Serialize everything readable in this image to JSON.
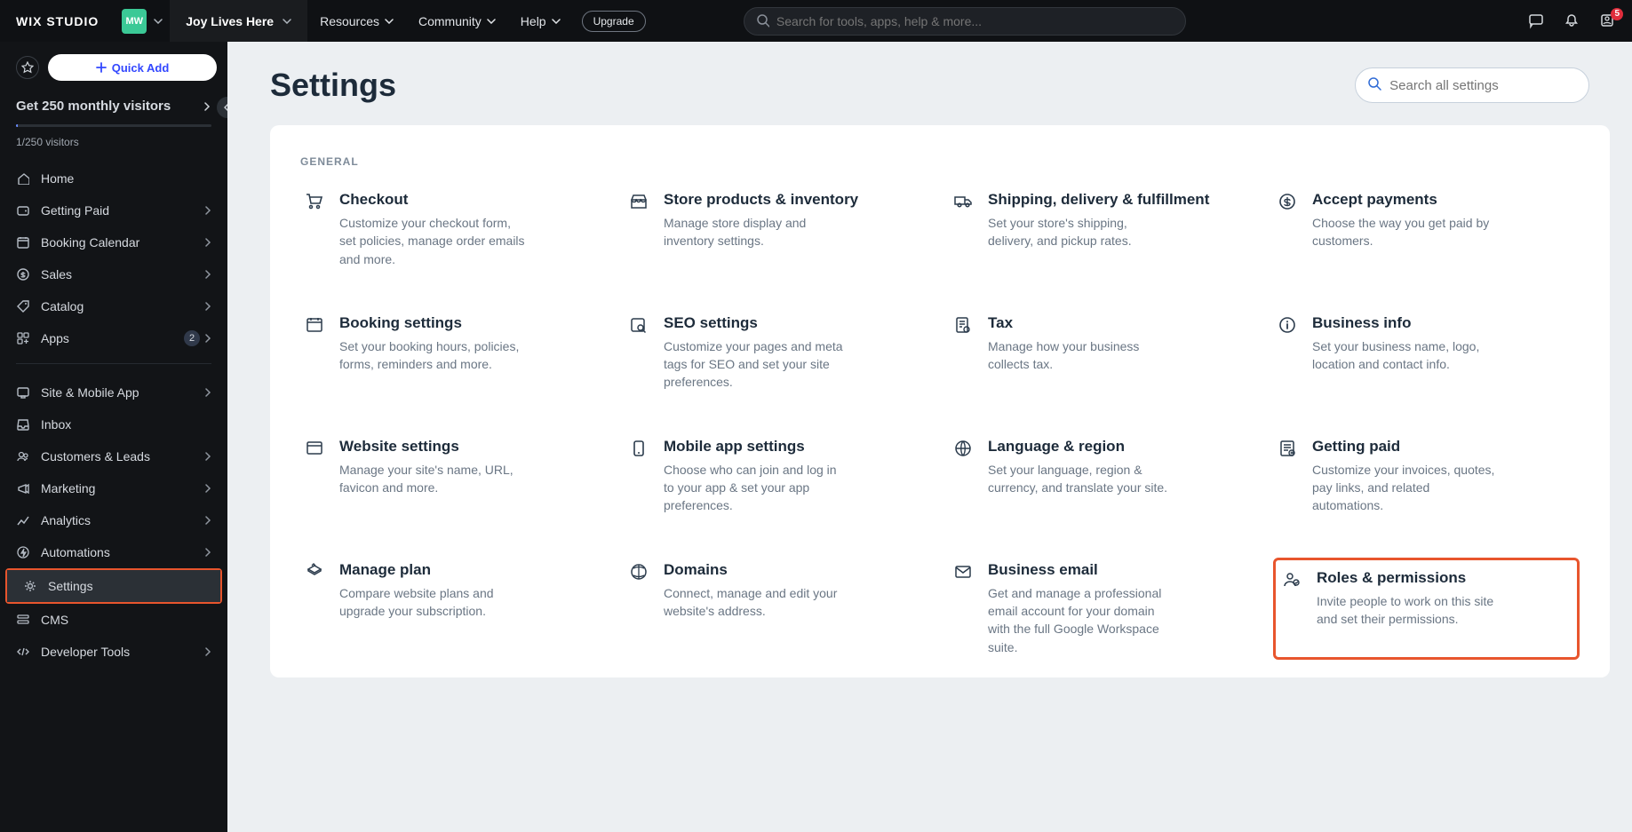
{
  "top": {
    "logo": "WIX STUDIO",
    "avatar_initials": "MW",
    "site_name": "Joy Lives Here",
    "nav": [
      "Resources",
      "Community",
      "Help"
    ],
    "upgrade": "Upgrade",
    "search_placeholder": "Search for tools, apps, help & more...",
    "badge_count": "5"
  },
  "sidebar": {
    "quick_add": "Quick Add",
    "visitors_title": "Get 250 monthly visitors",
    "visitors_count": "1/250 visitors",
    "items": [
      {
        "label": "Home",
        "icon": "home",
        "chev": false
      },
      {
        "label": "Getting Paid",
        "icon": "wallet",
        "chev": true
      },
      {
        "label": "Booking Calendar",
        "icon": "calendar",
        "chev": true
      },
      {
        "label": "Sales",
        "icon": "dollar",
        "chev": true
      },
      {
        "label": "Catalog",
        "icon": "tag",
        "chev": true
      },
      {
        "label": "Apps",
        "icon": "apps",
        "chev": true,
        "badge": "2"
      }
    ],
    "items2": [
      {
        "label": "Site & Mobile App",
        "icon": "site",
        "chev": true
      },
      {
        "label": "Inbox",
        "icon": "inbox",
        "chev": false
      },
      {
        "label": "Customers & Leads",
        "icon": "users",
        "chev": true
      },
      {
        "label": "Marketing",
        "icon": "mega",
        "chev": true
      },
      {
        "label": "Analytics",
        "icon": "chart",
        "chev": true
      },
      {
        "label": "Automations",
        "icon": "bolt",
        "chev": true
      },
      {
        "label": "Settings",
        "icon": "gear",
        "chev": false,
        "active": true
      },
      {
        "label": "CMS",
        "icon": "cms",
        "chev": false
      },
      {
        "label": "Developer Tools",
        "icon": "dev",
        "chev": true
      }
    ]
  },
  "main": {
    "title": "Settings",
    "search_placeholder": "Search all settings",
    "section": "GENERAL",
    "cards": [
      {
        "title": "Checkout",
        "desc": "Customize your checkout form, set policies, manage order emails and more.",
        "icon": "cart"
      },
      {
        "title": "Store products & inventory",
        "desc": "Manage store display and inventory settings.",
        "icon": "store"
      },
      {
        "title": "Shipping, delivery & fulfillment",
        "desc": "Set your store's shipping, delivery, and pickup rates.",
        "icon": "truck"
      },
      {
        "title": "Accept payments",
        "desc": "Choose the way you get paid by customers.",
        "icon": "pay"
      },
      {
        "title": "Booking settings",
        "desc": "Set your booking hours, policies, forms, reminders and more.",
        "icon": "book"
      },
      {
        "title": "SEO settings",
        "desc": "Customize your pages and meta tags for SEO and set your site preferences.",
        "icon": "seo"
      },
      {
        "title": "Tax",
        "desc": "Manage how your business collects tax.",
        "icon": "tax"
      },
      {
        "title": "Business info",
        "desc": "Set your business name, logo, location and contact info.",
        "icon": "info"
      },
      {
        "title": "Website settings",
        "desc": "Manage your site's name, URL, favicon and more.",
        "icon": "web"
      },
      {
        "title": "Mobile app settings",
        "desc": "Choose who can join and log in to your app & set your app preferences.",
        "icon": "mobile"
      },
      {
        "title": "Language & region",
        "desc": "Set your language, region & currency, and translate your site.",
        "icon": "globe"
      },
      {
        "title": "Getting paid",
        "desc": "Customize your invoices, quotes, pay links, and related automations.",
        "icon": "invoice"
      },
      {
        "title": "Manage plan",
        "desc": "Compare website plans and upgrade your subscription.",
        "icon": "plan"
      },
      {
        "title": "Domains",
        "desc": "Connect, manage and edit your website's address.",
        "icon": "domain"
      },
      {
        "title": "Business email",
        "desc": "Get and manage a professional email account for your domain with the full Google Workspace suite.",
        "icon": "email"
      },
      {
        "title": "Roles & permissions",
        "desc": "Invite people to work on this site and set their permissions.",
        "icon": "roles",
        "highlight": true
      }
    ]
  }
}
